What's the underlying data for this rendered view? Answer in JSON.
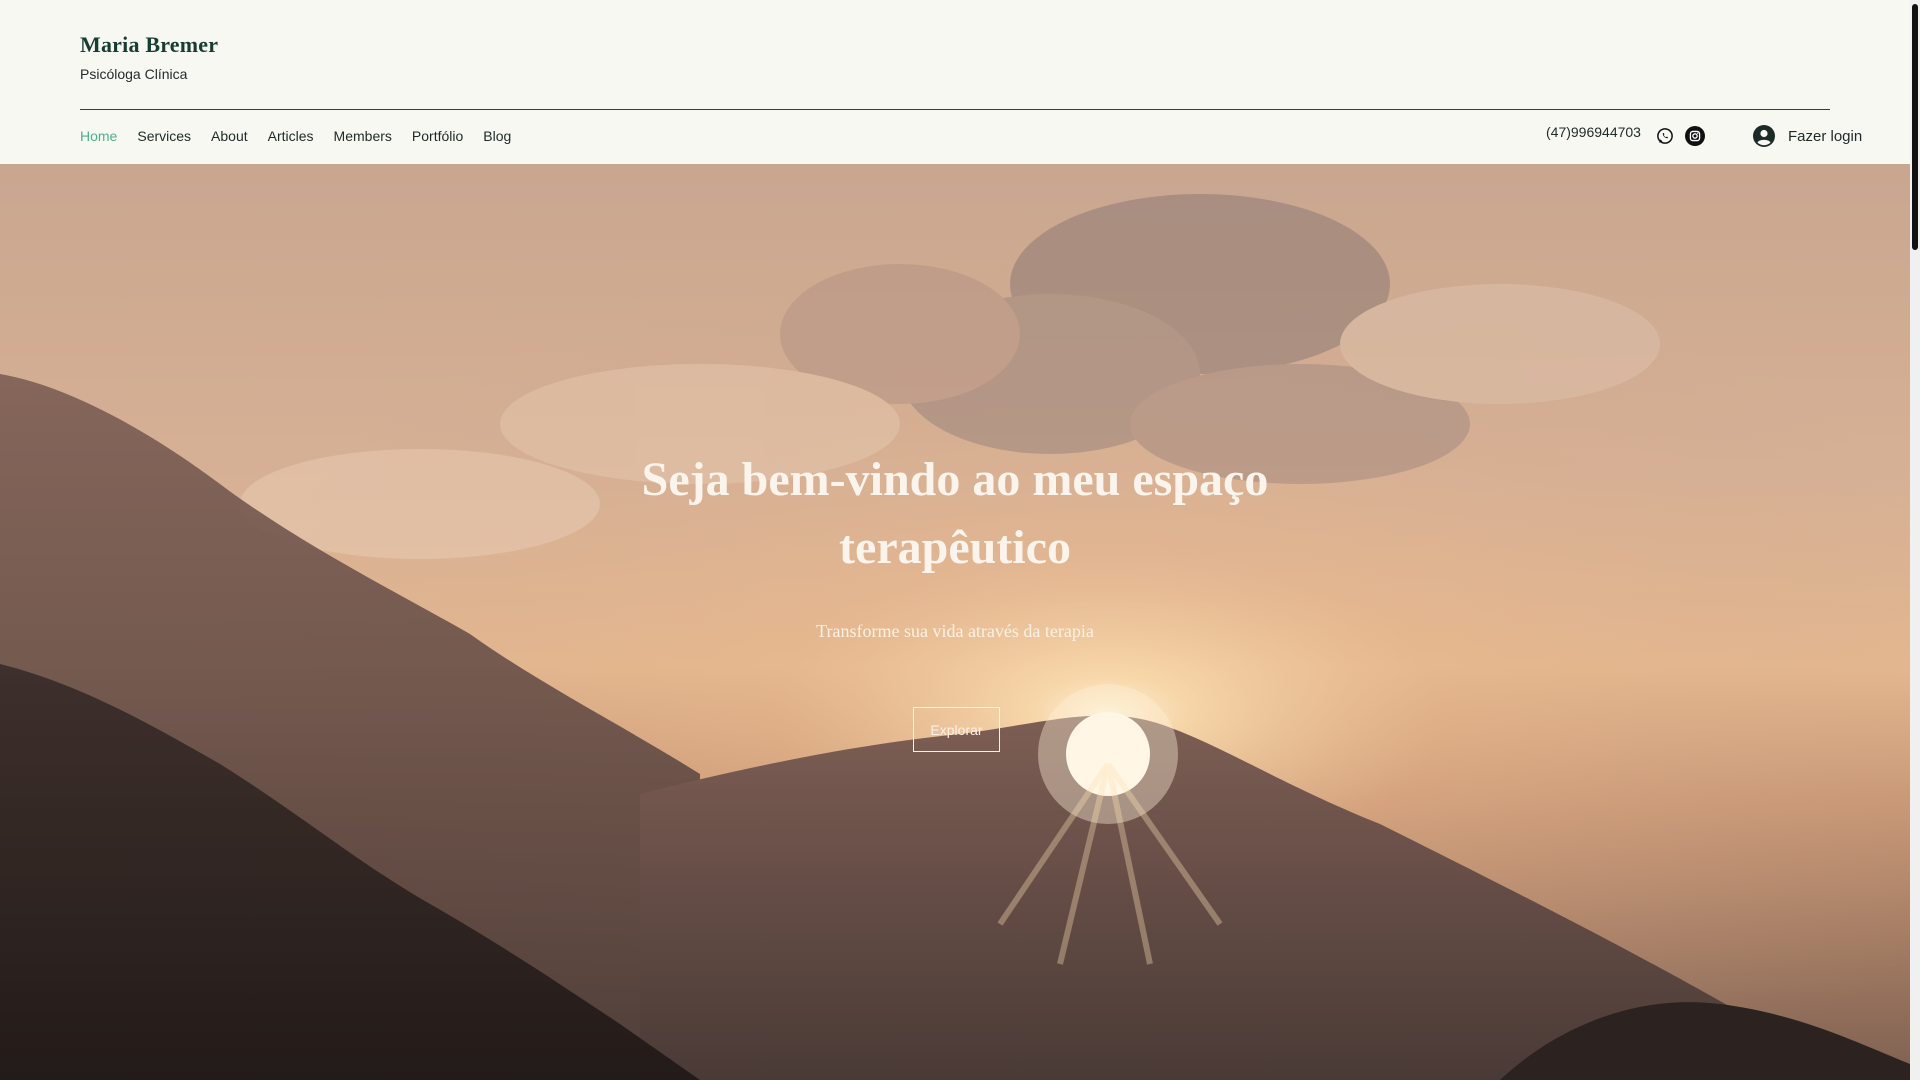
{
  "header": {
    "brand_name": "Maria Bremer",
    "brand_subtitle": "Psicóloga Clínica",
    "nav": [
      {
        "label": "Home",
        "active": true
      },
      {
        "label": "Services"
      },
      {
        "label": "About"
      },
      {
        "label": "Articles"
      },
      {
        "label": "Members"
      },
      {
        "label": "Portfólio"
      },
      {
        "label": "Blog"
      }
    ],
    "phone": "(47)996944703",
    "social": [
      {
        "icon": "whatsapp-icon"
      },
      {
        "icon": "instagram-icon"
      }
    ],
    "login_label": "Fazer login"
  },
  "hero": {
    "title": "Seja bem-vindo ao meu espaço terapêutico",
    "subtitle": "Transforme sua vida através da terapia",
    "button_label": "Explorar"
  },
  "colors": {
    "brand": "#183d33",
    "nav_active": "#4eaf8f",
    "header_bg": "#f8f8f3"
  }
}
